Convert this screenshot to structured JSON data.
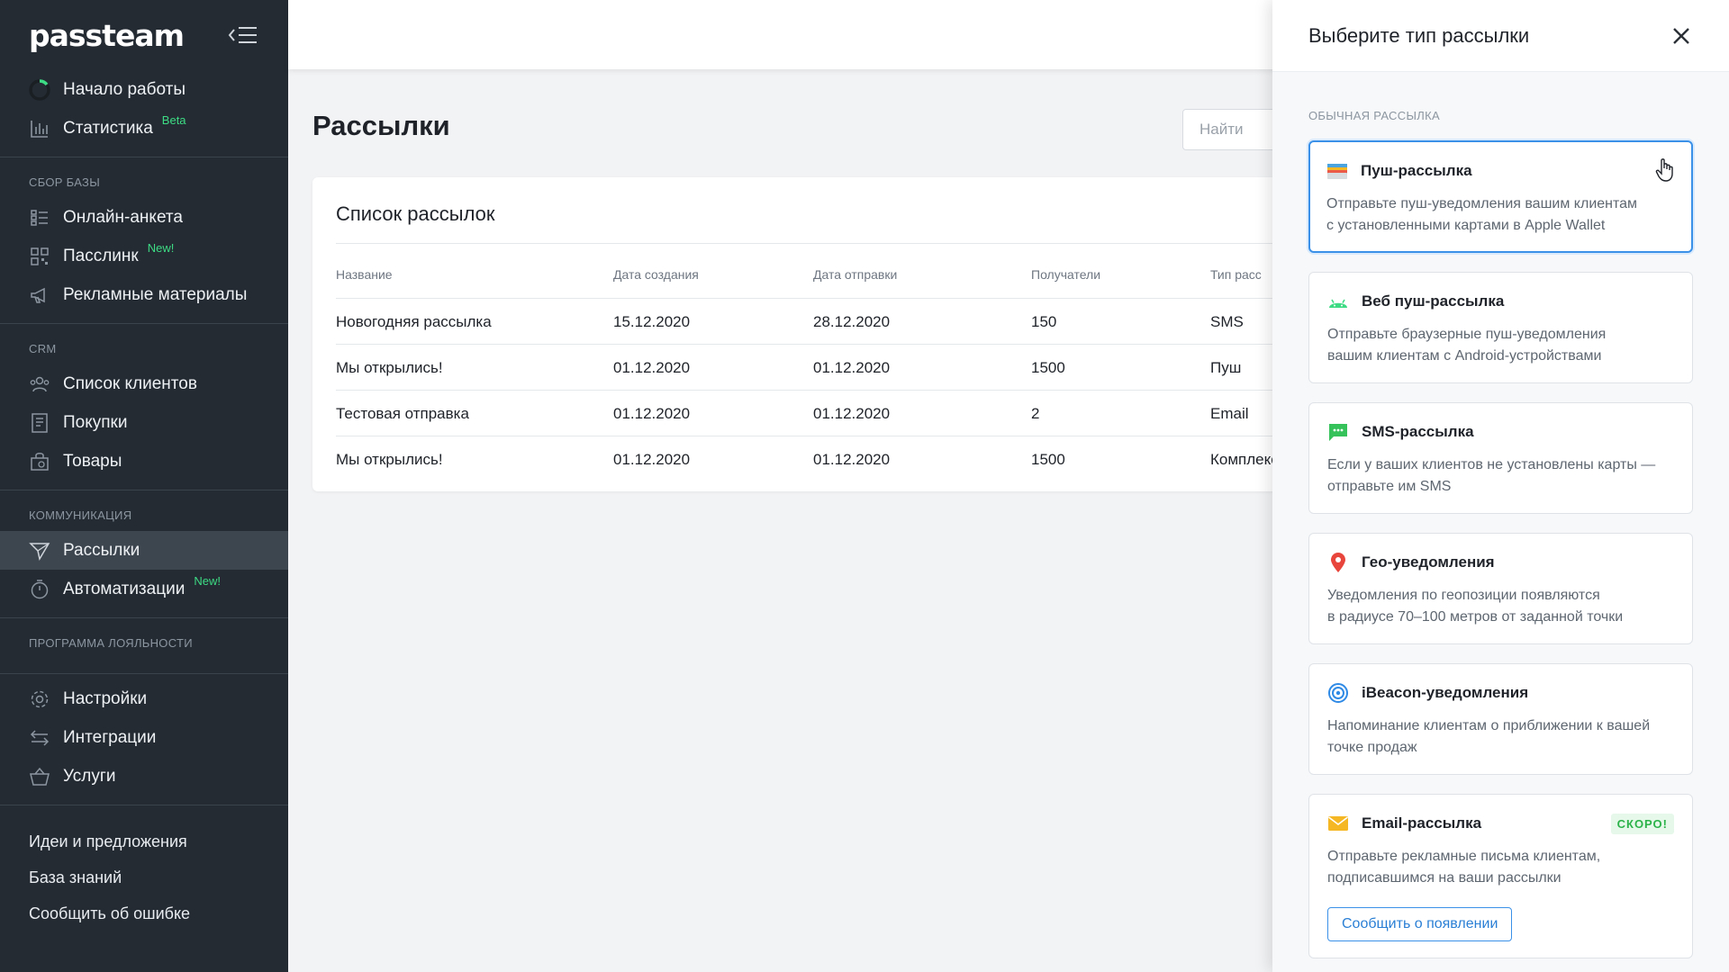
{
  "app": {
    "logo": "passteam"
  },
  "sidebar": {
    "top_items": [
      {
        "label": "Начало работы",
        "icon": "progress-ring-icon"
      },
      {
        "label": "Статистика",
        "icon": "chart-icon",
        "badge": "Beta"
      }
    ],
    "sections": [
      {
        "title": "Сбор базы",
        "items": [
          {
            "label": "Онлайн-анкета",
            "icon": "form-icon"
          },
          {
            "label": "Пасслинк",
            "icon": "qr-icon",
            "badge": "New!"
          },
          {
            "label": "Рекламные материалы",
            "icon": "megaphone-icon"
          }
        ]
      },
      {
        "title": "CRM",
        "items": [
          {
            "label": "Список клиентов",
            "icon": "users-icon"
          },
          {
            "label": "Покупки",
            "icon": "receipt-icon"
          },
          {
            "label": "Товары",
            "icon": "bag-icon"
          }
        ]
      },
      {
        "title": "Коммуникация",
        "items": [
          {
            "label": "Рассылки",
            "icon": "send-icon",
            "active": true
          },
          {
            "label": "Автоматизации",
            "icon": "timer-icon",
            "badge": "New!"
          }
        ]
      },
      {
        "title": "Программа лояльности",
        "items": []
      }
    ],
    "bottom_items": [
      {
        "label": "Настройки",
        "icon": "gear-icon"
      },
      {
        "label": "Интеграции",
        "icon": "swap-icon"
      },
      {
        "label": "Услуги",
        "icon": "basket-icon"
      }
    ],
    "links": [
      "Идеи и предложения",
      "База знаний",
      "Сообщить об ошибке"
    ]
  },
  "main": {
    "title": "Рассылки",
    "search_placeholder": "Найти",
    "card_title": "Список рассылок",
    "columns": [
      "Название",
      "Дата создания",
      "Дата отправки",
      "Получатели",
      "Тип расс"
    ],
    "rows": [
      [
        "Новогодняя рассылка",
        "15.12.2020",
        "28.12.2020",
        "150",
        "SMS"
      ],
      [
        "Мы открылись!",
        "01.12.2020",
        "01.12.2020",
        "1500",
        "Пуш"
      ],
      [
        "Тестовая отправка",
        "01.12.2020",
        "01.12.2020",
        "2",
        "Email"
      ],
      [
        "Мы открылись!",
        "01.12.2020",
        "01.12.2020",
        "1500",
        "Комплекс"
      ]
    ]
  },
  "panel": {
    "title": "Выберите тип рассылки",
    "section": "Обычная рассылка",
    "options": [
      {
        "title": "Пуш-рассылка",
        "desc1": "Отправьте пуш-уведомления вашим клиентам",
        "desc2": "с установленными картами в Apple Wallet",
        "icon": "wallet-icon",
        "selected": true
      },
      {
        "title": "Веб пуш-рассылка",
        "desc1": "Отправьте браузерные пуш-уведомления",
        "desc2": "вашим клиентам с Android-устройствами",
        "icon": "android-icon"
      },
      {
        "title": "SMS-рассылка",
        "desc1": "Если у ваших клиентов не установлены карты —",
        "desc2": "отправьте им SMS",
        "icon": "sms-icon"
      },
      {
        "title": "Гео-уведомления",
        "desc1": "Уведомления по геопозиции появляются",
        "desc2": "в радиусе 70–100 метров от заданной точки",
        "icon": "location-pin-icon"
      },
      {
        "title": "iBeacon-уведомления",
        "desc1": "Напоминание клиентам о приближении к вашей",
        "desc2": "точке продаж",
        "icon": "beacon-icon"
      },
      {
        "title": "Email-рассылка",
        "desc1": "Отправьте рекламные письма клиентам,",
        "desc2": "подписавшимся на ваши рассылки",
        "icon": "envelope-icon",
        "badge": "Скоро!",
        "button": "Сообщить о появлении"
      }
    ]
  },
  "colors": {
    "sidebar_bg": "#242b33",
    "accent": "#3b91e8",
    "new_badge": "#3ddc84"
  }
}
